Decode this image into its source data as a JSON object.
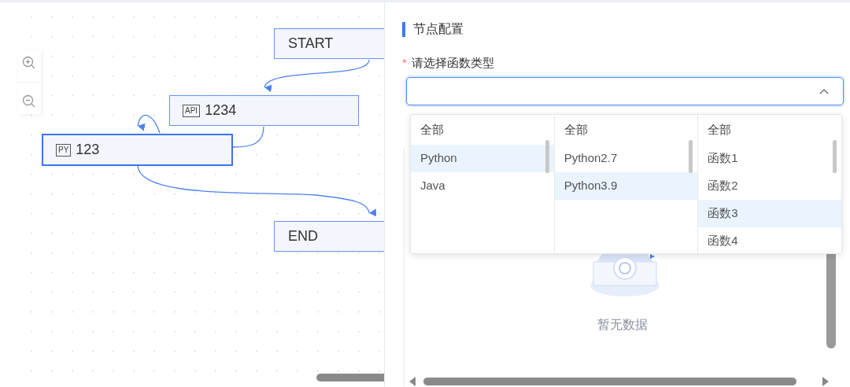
{
  "canvas": {
    "nodes": [
      {
        "kind": "terminal",
        "label": "START",
        "selected": false
      },
      {
        "kind": "api",
        "badge": "API",
        "label": "1234",
        "selected": false
      },
      {
        "kind": "python",
        "badge": "PY",
        "label": "123",
        "selected": true
      },
      {
        "kind": "terminal",
        "label": "END",
        "selected": false
      }
    ]
  },
  "panel": {
    "title": "节点配置",
    "field": {
      "label": "请选择函数类型",
      "required_mark": "*",
      "expanded": true
    },
    "cascader": [
      {
        "header": "全部",
        "options": [
          {
            "label": "Python",
            "selected": true
          },
          {
            "label": "Java",
            "selected": false
          }
        ]
      },
      {
        "header": "全部",
        "options": [
          {
            "label": "Python2.7",
            "selected": false
          },
          {
            "label": "Python3.9",
            "selected": true
          }
        ]
      },
      {
        "header": "全部",
        "options": [
          {
            "label": "函数1",
            "selected": false
          },
          {
            "label": "函数2",
            "selected": false
          },
          {
            "label": "函数3",
            "selected": true
          },
          {
            "label": "函数4",
            "selected": false
          }
        ]
      }
    ],
    "empty_text": "暂无数据"
  }
}
